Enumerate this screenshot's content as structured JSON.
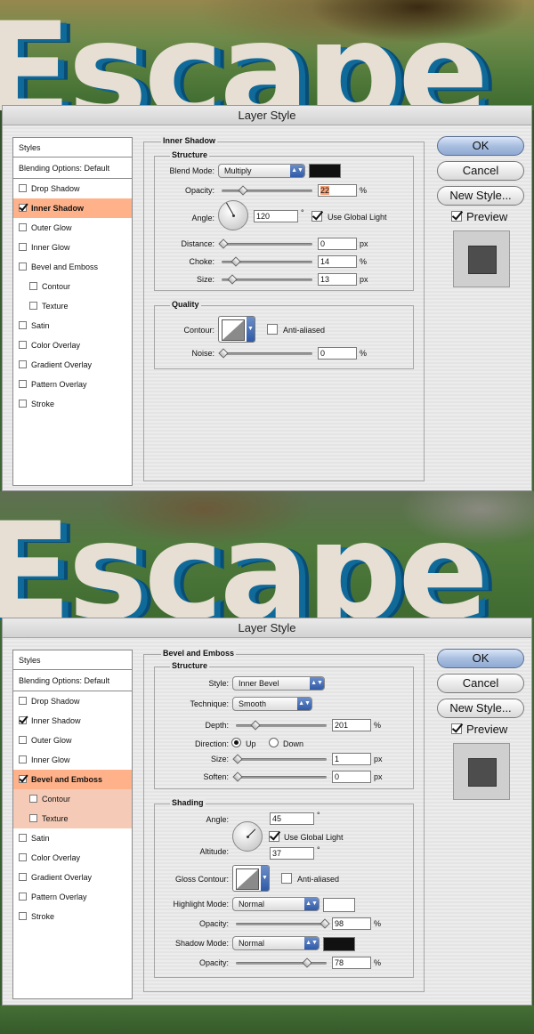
{
  "background_text": "Escape",
  "dialog1": {
    "title": "Layer Style",
    "styles_header": "Styles",
    "blending_options": "Blending Options: Default",
    "style_items": [
      {
        "label": "Drop Shadow",
        "checked": false,
        "selected": false
      },
      {
        "label": "Inner Shadow",
        "checked": true,
        "selected": true
      },
      {
        "label": "Outer Glow",
        "checked": false,
        "selected": false
      },
      {
        "label": "Inner Glow",
        "checked": false,
        "selected": false
      },
      {
        "label": "Bevel and Emboss",
        "checked": false,
        "selected": false
      },
      {
        "label": "Contour",
        "checked": false,
        "selected": false,
        "sub": true
      },
      {
        "label": "Texture",
        "checked": false,
        "selected": false,
        "sub": true
      },
      {
        "label": "Satin",
        "checked": false,
        "selected": false
      },
      {
        "label": "Color Overlay",
        "checked": false,
        "selected": false
      },
      {
        "label": "Gradient Overlay",
        "checked": false,
        "selected": false
      },
      {
        "label": "Pattern Overlay",
        "checked": false,
        "selected": false
      },
      {
        "label": "Stroke",
        "checked": false,
        "selected": false
      }
    ],
    "section_title": "Inner Shadow",
    "structure_title": "Structure",
    "blend_mode_label": "Blend Mode:",
    "blend_mode_value": "Multiply",
    "shadow_color": "#111111",
    "opacity_label": "Opacity:",
    "opacity_value": "22",
    "angle_label": "Angle:",
    "angle_value": "120",
    "use_global_light": "Use Global Light",
    "distance_label": "Distance:",
    "distance_value": "0",
    "choke_label": "Choke:",
    "choke_value": "14",
    "size_label": "Size:",
    "size_value": "13",
    "quality_title": "Quality",
    "contour_label": "Contour:",
    "anti_aliased": "Anti-aliased",
    "noise_label": "Noise:",
    "noise_value": "0",
    "unit_percent": "%",
    "unit_px": "px",
    "degree": "°",
    "ok": "OK",
    "cancel": "Cancel",
    "new_style": "New Style...",
    "preview": "Preview"
  },
  "dialog2": {
    "title": "Layer Style",
    "styles_header": "Styles",
    "blending_options": "Blending Options: Default",
    "style_items": [
      {
        "label": "Drop Shadow",
        "checked": false,
        "selected": false
      },
      {
        "label": "Inner Shadow",
        "checked": true,
        "selected": false
      },
      {
        "label": "Outer Glow",
        "checked": false,
        "selected": false
      },
      {
        "label": "Inner Glow",
        "checked": false,
        "selected": false
      },
      {
        "label": "Bevel and Emboss",
        "checked": true,
        "selected": true
      },
      {
        "label": "Contour",
        "checked": false,
        "selected": false,
        "sub": true
      },
      {
        "label": "Texture",
        "checked": false,
        "selected": false,
        "sub": true
      },
      {
        "label": "Satin",
        "checked": false,
        "selected": false
      },
      {
        "label": "Color Overlay",
        "checked": false,
        "selected": false
      },
      {
        "label": "Gradient Overlay",
        "checked": false,
        "selected": false
      },
      {
        "label": "Pattern Overlay",
        "checked": false,
        "selected": false
      },
      {
        "label": "Stroke",
        "checked": false,
        "selected": false
      }
    ],
    "section_title": "Bevel and Emboss",
    "structure_title": "Structure",
    "style_label": "Style:",
    "style_value": "Inner Bevel",
    "technique_label": "Technique:",
    "technique_value": "Smooth",
    "depth_label": "Depth:",
    "depth_value": "201",
    "direction_label": "Direction:",
    "direction_up": "Up",
    "direction_down": "Down",
    "size_label": "Size:",
    "size_value": "1",
    "soften_label": "Soften:",
    "soften_value": "0",
    "shading_title": "Shading",
    "angle_label": "Angle:",
    "angle_value": "45",
    "use_global_light": "Use Global Light",
    "altitude_label": "Altitude:",
    "altitude_value": "37",
    "gloss_contour_label": "Gloss Contour:",
    "anti_aliased": "Anti-aliased",
    "highlight_mode_label": "Highlight Mode:",
    "highlight_mode_value": "Normal",
    "highlight_color": "#ffffff",
    "highlight_opacity_label": "Opacity:",
    "highlight_opacity_value": "98",
    "shadow_mode_label": "Shadow Mode:",
    "shadow_mode_value": "Normal",
    "shadow_color": "#111111",
    "shadow_opacity_label": "Opacity:",
    "shadow_opacity_value": "78",
    "unit_percent": "%",
    "unit_px": "px",
    "degree": "°",
    "ok": "OK",
    "cancel": "Cancel",
    "new_style": "New Style...",
    "preview": "Preview"
  }
}
